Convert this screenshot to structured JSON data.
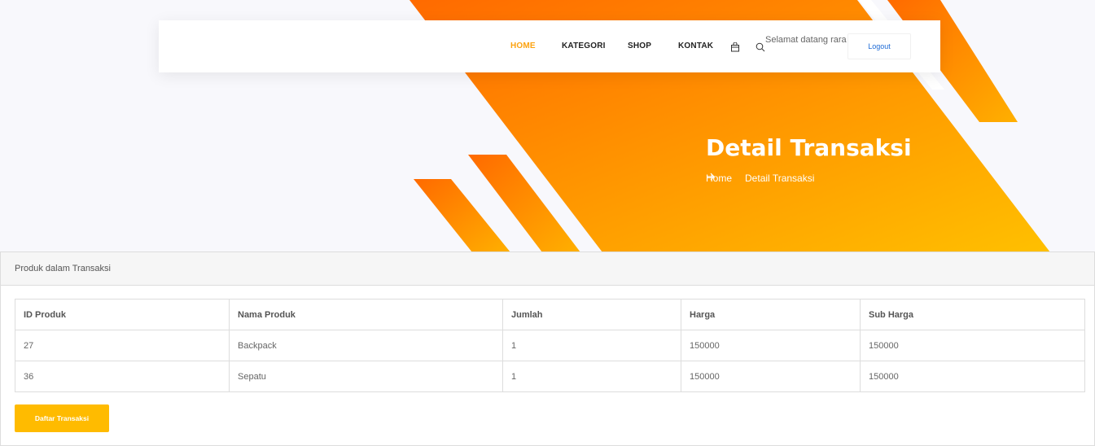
{
  "nav": {
    "items": [
      {
        "label": "HOME",
        "active": true
      },
      {
        "label": "KATEGORI",
        "active": false
      },
      {
        "label": "SHOP",
        "active": false
      },
      {
        "label": "KONTAK",
        "active": false
      }
    ],
    "greeting": "Selamat datang rara",
    "logout_label": "Logout",
    "icons": [
      "cart-icon",
      "search-icon"
    ]
  },
  "hero": {
    "title": "Detail Transaksi",
    "breadcrumb": [
      "Home",
      "Detail Transaksi"
    ]
  },
  "card": {
    "header": "Produk dalam Transaksi",
    "columns": [
      "ID Produk",
      "Nama Produk",
      "Jumlah",
      "Harga",
      "Sub Harga"
    ],
    "rows": [
      [
        "27",
        "Backpack",
        "1",
        "150000",
        "150000"
      ],
      [
        "36",
        "Sepatu",
        "1",
        "150000",
        "150000"
      ]
    ],
    "button_label": "Daftar Transaksi"
  },
  "colors": {
    "accent": "#fca311",
    "button": "#ffbb00",
    "hero_gradient_start": "#ff6a00",
    "hero_gradient_end": "#ffc000",
    "link": "#1e6bd6"
  }
}
